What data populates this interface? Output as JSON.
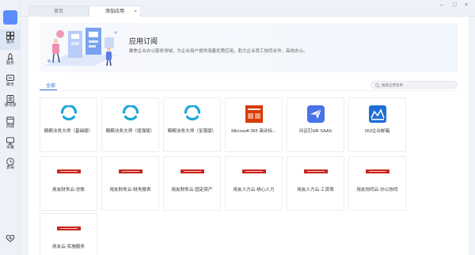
{
  "sidebar": {
    "items": [
      {
        "label": "首页",
        "icon": "home-grid-icon"
      },
      {
        "label": "服务",
        "icon": "rocket-icon"
      },
      {
        "label": "聊天",
        "icon": "chat-icon"
      },
      {
        "label": "通讯录",
        "icon": "contacts-icon"
      },
      {
        "label": "商城",
        "icon": "store-icon"
      },
      {
        "label": "设备",
        "icon": "monitor-icon"
      },
      {
        "label": "表哥",
        "icon": "clock-icon"
      }
    ]
  },
  "tabs": {
    "home": "首页",
    "add_app": "添加应用",
    "close": "×"
  },
  "window": {
    "minimize": "–",
    "maximize": "□",
    "close": "×"
  },
  "banner": {
    "title": "应用订阅",
    "description": "聚焦企业办公服务领域，为企业用户提供海量优质应用，助力企业员工协同合作，高效办公。"
  },
  "category": {
    "active": "全部"
  },
  "search": {
    "placeholder": "搜索应用名称"
  },
  "apps": [
    {
      "name": "殿殿法务大师（基础版）",
      "icon": "fadada-icon"
    },
    {
      "name": "殿殿法务大师（增强版）",
      "icon": "fadada-icon"
    },
    {
      "name": "殿殿法务大师（至尊版）",
      "icon": "fadada-icon"
    },
    {
      "name": "Microsoft 365 商业标...",
      "icon": "microsoft-icon"
    },
    {
      "name": "问吕钉HR SAAS",
      "icon": "paper-plane-icon"
    },
    {
      "name": "263企业邮箱",
      "icon": "mail263-icon"
    },
    {
      "name": "用友财务云-总账",
      "icon": "yonyou-icon"
    },
    {
      "name": "用友财务云-财务报表",
      "icon": "yonyou-icon"
    },
    {
      "name": "用友财务云-固定资产",
      "icon": "yonyou-icon"
    },
    {
      "name": "用友人力云-核心人力",
      "icon": "yonyou-icon"
    },
    {
      "name": "用友人力云-工资表",
      "icon": "yonyou-icon"
    },
    {
      "name": "用友协同云-办公协同",
      "icon": "yonyou-icon"
    },
    {
      "name": "用友云-实施服务",
      "icon": "yonyou-icon"
    }
  ],
  "colors": {
    "accent": "#2f6fe4",
    "logo": "#5b8cff",
    "yonyou_red": "#c9261f",
    "fadada_blue": "#1aa6d9"
  }
}
